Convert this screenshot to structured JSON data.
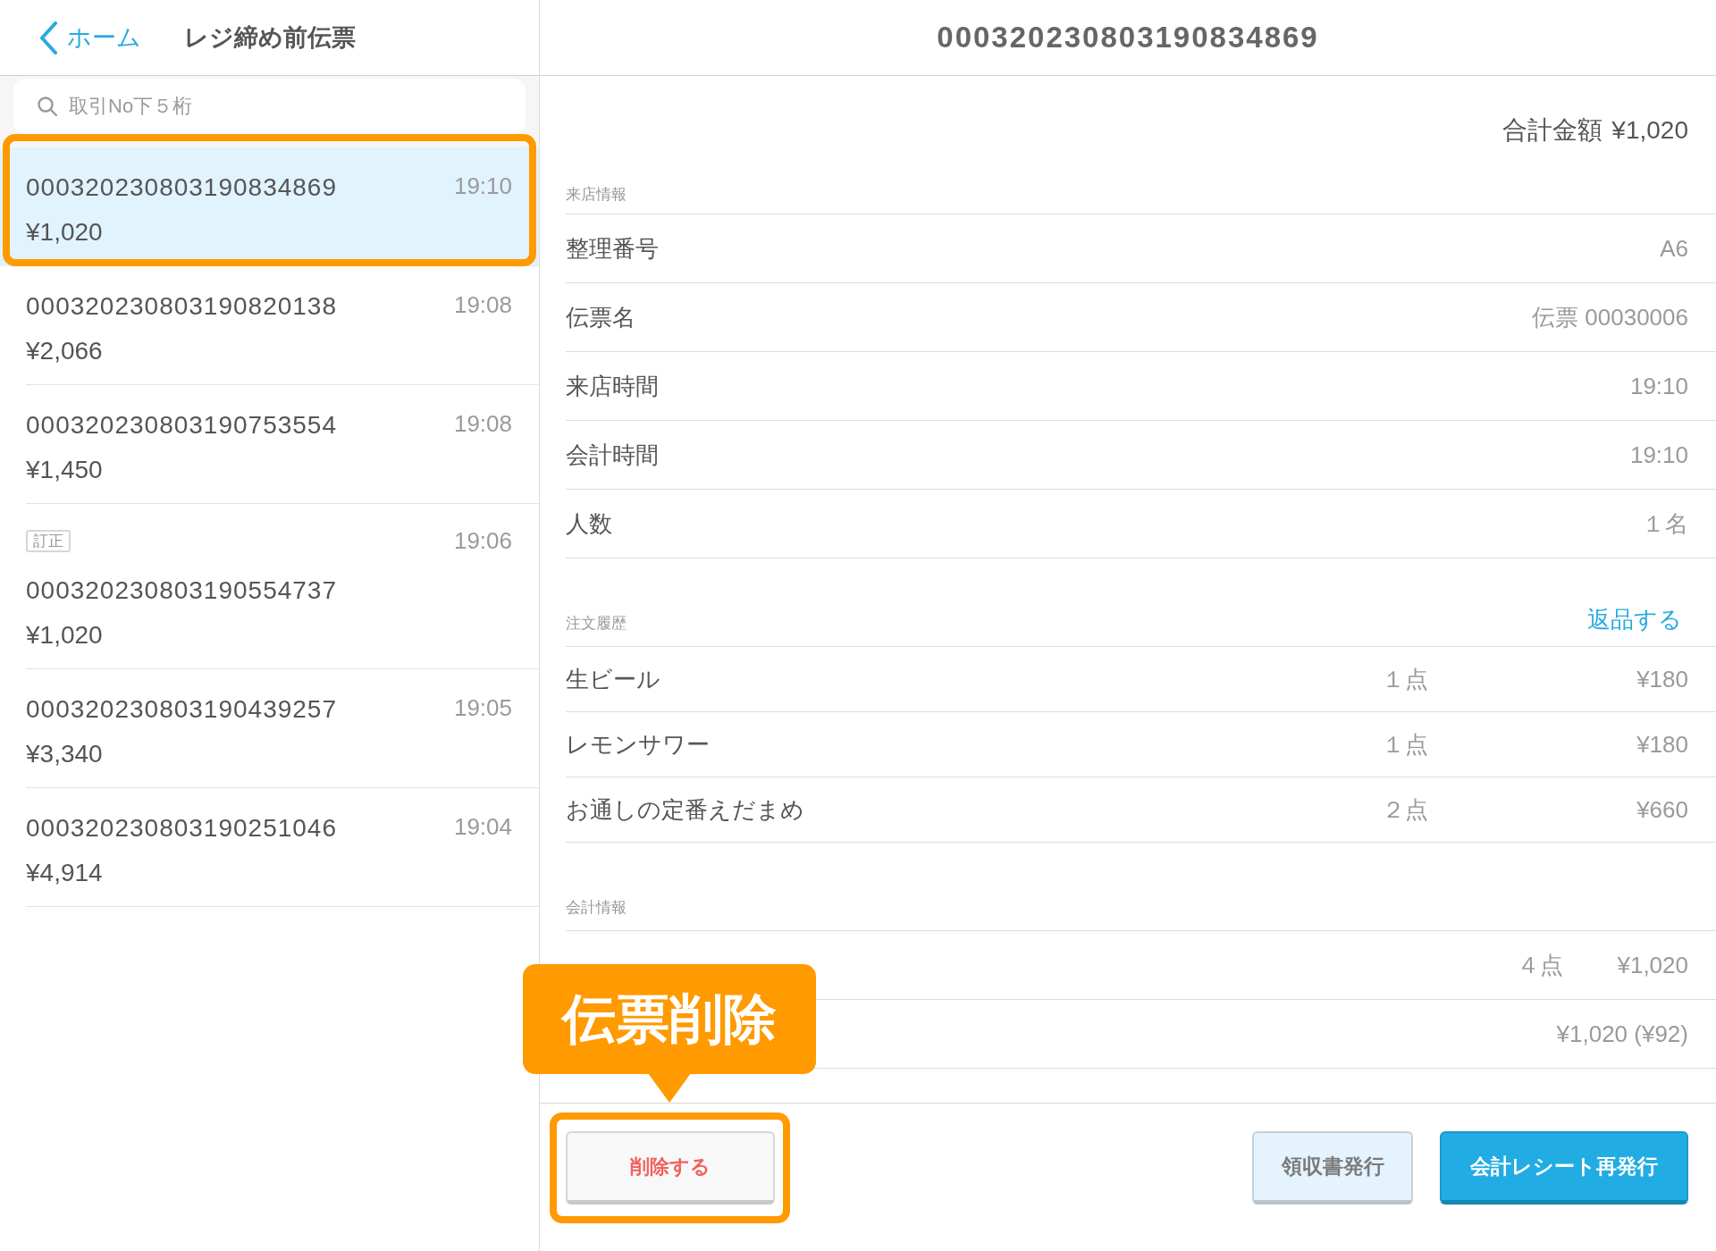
{
  "nav": {
    "back": "ホーム",
    "title": "レジ締め前伝票"
  },
  "search": {
    "placeholder": "取引No下５桁"
  },
  "slips": [
    {
      "number": "000320230803190834869",
      "amount": "¥1,020",
      "time": "19:10",
      "selected": true,
      "highlighted": true
    },
    {
      "number": "000320230803190820138",
      "amount": "¥2,066",
      "time": "19:08",
      "selected": false,
      "highlighted": false
    },
    {
      "number": "000320230803190753554",
      "amount": "¥1,450",
      "time": "19:08",
      "selected": false,
      "highlighted": false
    },
    {
      "tag": "訂正",
      "number": "000320230803190554737",
      "amount": "¥1,020",
      "time": "19:06",
      "selected": false,
      "highlighted": false
    },
    {
      "number": "000320230803190439257",
      "amount": "¥3,340",
      "time": "19:05",
      "selected": false,
      "highlighted": false
    },
    {
      "number": "000320230803190251046",
      "amount": "¥4,914",
      "time": "19:04",
      "selected": false,
      "highlighted": false
    }
  ],
  "detail": {
    "title": "000320230803190834869",
    "total_label": "合計金額",
    "total": "¥1,020",
    "sections": [
      {
        "kind": "info",
        "heading": "来店情報",
        "rows": [
          {
            "label": "整理番号",
            "value": "A6"
          },
          {
            "label": "伝票名",
            "value": "伝票 00030006"
          },
          {
            "label": "来店時間",
            "value": "19:10"
          },
          {
            "label": "会計時間",
            "value": "19:10"
          },
          {
            "label": "人数",
            "value": "１名"
          }
        ]
      },
      {
        "kind": "order",
        "heading": "注文履歴",
        "action": "返品する",
        "rows": [
          {
            "name": "生ビール",
            "quantity": "１点",
            "price": "¥180"
          },
          {
            "name": "レモンサワー",
            "quantity": "１点",
            "price": "¥180"
          },
          {
            "name": "お通しの定番えだまめ",
            "quantity": "２点",
            "price": "¥660"
          }
        ]
      },
      {
        "kind": "payment",
        "heading": "会計情報",
        "rows": [
          {
            "quantity": "４点",
            "amount": "¥1,020"
          },
          {
            "amount": "¥1,020 (¥92)"
          }
        ]
      }
    ]
  },
  "footer": {
    "buttons": [
      {
        "label": "削除する",
        "kind": "danger",
        "highlighted": true
      },
      {
        "label": "領収書発行",
        "kind": "secondary",
        "highlighted": false
      },
      {
        "label": "会計レシート再発行",
        "kind": "primary",
        "highlighted": false
      }
    ]
  },
  "callout": {
    "text": "伝票削除"
  }
}
